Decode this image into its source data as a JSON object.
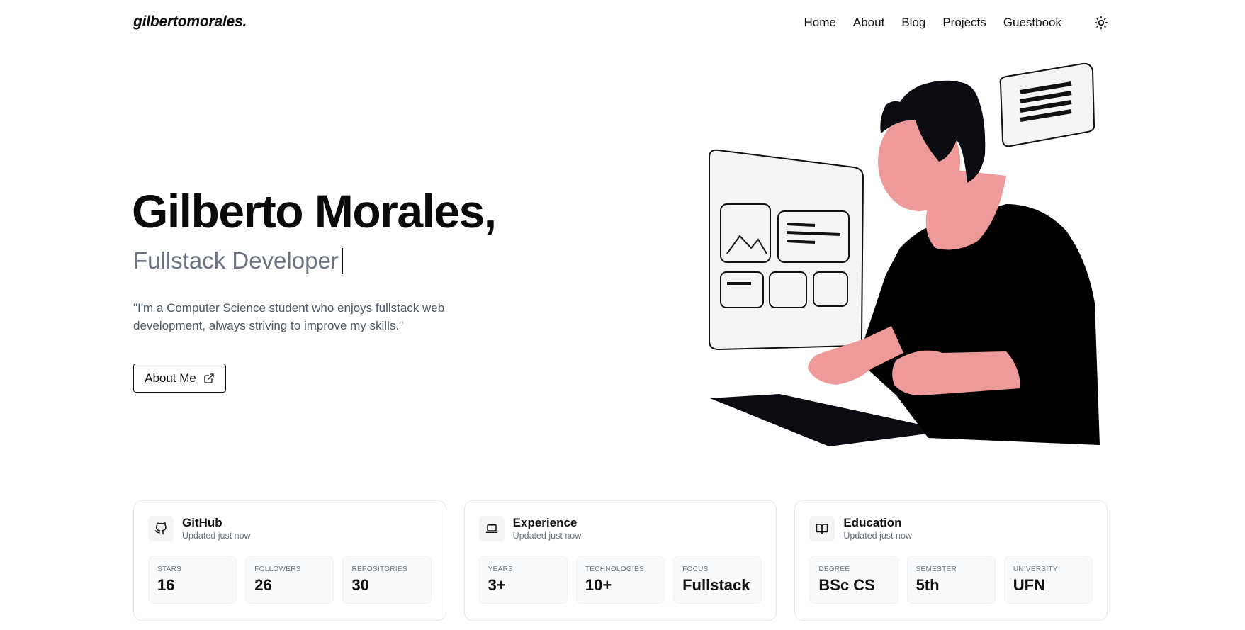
{
  "header": {
    "logo": "gilbertomorales.",
    "nav": [
      {
        "label": "Home"
      },
      {
        "label": "About"
      },
      {
        "label": "Blog"
      },
      {
        "label": "Projects"
      },
      {
        "label": "Guestbook"
      }
    ],
    "theme_icon": "sun-icon"
  },
  "hero": {
    "title": "Gilberto Morales,",
    "subtitle": "Fullstack Developer",
    "quote": "\"I'm a Computer Science student who enjoys fullstack web development, always striving to improve my skills.\"",
    "button_label": "About Me",
    "button_icon": "external-link-icon"
  },
  "cards": [
    {
      "icon": "github-icon",
      "title": "GitHub",
      "updated": "Updated just now",
      "stats": [
        {
          "label": "STARS",
          "value": "16"
        },
        {
          "label": "FOLLOWERS",
          "value": "26"
        },
        {
          "label": "REPOSITORIES",
          "value": "30"
        }
      ]
    },
    {
      "icon": "laptop-icon",
      "title": "Experience",
      "updated": "Updated just now",
      "stats": [
        {
          "label": "YEARS",
          "value": "3+"
        },
        {
          "label": "TECHNOLOGIES",
          "value": "10+"
        },
        {
          "label": "FOCUS",
          "value": "Fullstack"
        }
      ]
    },
    {
      "icon": "book-icon",
      "title": "Education",
      "updated": "Updated just now",
      "stats": [
        {
          "label": "DEGREE",
          "value": "BSc CS"
        },
        {
          "label": "SEMESTER",
          "value": "5th"
        },
        {
          "label": "UNIVERSITY",
          "value": "UFN"
        }
      ]
    }
  ],
  "colors": {
    "skin": "#ef9a9a",
    "dark": "#0b0b12",
    "muted_text": "#6b7280",
    "card_border": "#e5e7eb"
  }
}
